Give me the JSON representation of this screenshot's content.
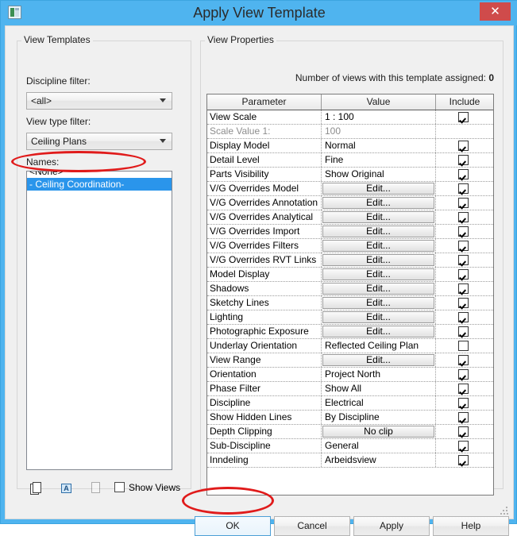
{
  "window": {
    "title": "Apply View Template",
    "app_icon": "application-window-icon",
    "close_label": "✕"
  },
  "left_panel": {
    "group_title": "View Templates",
    "discipline_filter": {
      "label": "Discipline filter:",
      "value": "<all>"
    },
    "view_type_filter": {
      "label": "View type filter:",
      "value": "Ceiling Plans"
    },
    "names": {
      "label": "Names:",
      "items": [
        {
          "text": "<None>",
          "selected": false
        },
        {
          "text": "- Ceiling Coordination-",
          "selected": true
        }
      ]
    },
    "tools": [
      {
        "name": "duplicate-icon",
        "title": "Duplicate",
        "enabled": true
      },
      {
        "name": "rename-icon",
        "title": "Rename",
        "enabled": true,
        "glyph": "A"
      },
      {
        "name": "delete-icon",
        "title": "Delete",
        "enabled": false
      }
    ],
    "show_views": {
      "label": "Show Views",
      "checked": false
    }
  },
  "right_panel": {
    "group_title": "View Properties",
    "views_assigned_label": "Number of views with this template assigned:",
    "views_assigned_count": "0",
    "columns": [
      "Parameter",
      "Value",
      "Include"
    ],
    "rows": [
      {
        "parameter": "View Scale",
        "value": "1 : 100",
        "type": "text",
        "include": true,
        "disabled": false
      },
      {
        "parameter": "Scale Value      1:",
        "value": "100",
        "type": "text",
        "include": null,
        "disabled": true
      },
      {
        "parameter": "Display Model",
        "value": "Normal",
        "type": "text",
        "include": true,
        "disabled": false
      },
      {
        "parameter": "Detail Level",
        "value": "Fine",
        "type": "text",
        "include": true,
        "disabled": false
      },
      {
        "parameter": "Parts Visibility",
        "value": "Show Original",
        "type": "text",
        "include": true,
        "disabled": false
      },
      {
        "parameter": "V/G Overrides Model",
        "value": "Edit...",
        "type": "button",
        "include": true,
        "disabled": false
      },
      {
        "parameter": "V/G Overrides Annotation",
        "value": "Edit...",
        "type": "button",
        "include": true,
        "disabled": false
      },
      {
        "parameter": "V/G Overrides Analytical",
        "value": "Edit...",
        "type": "button",
        "include": true,
        "disabled": false
      },
      {
        "parameter": "V/G Overrides Import",
        "value": "Edit...",
        "type": "button",
        "include": true,
        "disabled": false
      },
      {
        "parameter": "V/G Overrides Filters",
        "value": "Edit...",
        "type": "button",
        "include": true,
        "disabled": false
      },
      {
        "parameter": "V/G Overrides RVT Links",
        "value": "Edit...",
        "type": "button",
        "include": true,
        "disabled": false
      },
      {
        "parameter": "Model Display",
        "value": "Edit...",
        "type": "button",
        "include": true,
        "disabled": false
      },
      {
        "parameter": "Shadows",
        "value": "Edit...",
        "type": "button",
        "include": true,
        "disabled": false
      },
      {
        "parameter": "Sketchy Lines",
        "value": "Edit...",
        "type": "button",
        "include": true,
        "disabled": false
      },
      {
        "parameter": "Lighting",
        "value": "Edit...",
        "type": "button",
        "include": true,
        "disabled": false
      },
      {
        "parameter": "Photographic Exposure",
        "value": "Edit...",
        "type": "button",
        "include": true,
        "disabled": false
      },
      {
        "parameter": "Underlay Orientation",
        "value": "Reflected Ceiling Plan",
        "type": "text",
        "include": false,
        "disabled": false
      },
      {
        "parameter": "View Range",
        "value": "Edit...",
        "type": "button",
        "include": true,
        "disabled": false
      },
      {
        "parameter": "Orientation",
        "value": "Project North",
        "type": "text",
        "include": true,
        "disabled": false
      },
      {
        "parameter": "Phase Filter",
        "value": "Show All",
        "type": "text",
        "include": true,
        "disabled": false
      },
      {
        "parameter": "Discipline",
        "value": "Electrical",
        "type": "text",
        "include": true,
        "disabled": false
      },
      {
        "parameter": "Show Hidden Lines",
        "value": "By Discipline",
        "type": "text",
        "include": true,
        "disabled": false
      },
      {
        "parameter": "Depth Clipping",
        "value": "No clip",
        "type": "button",
        "include": true,
        "disabled": false
      },
      {
        "parameter": "Sub-Discipline",
        "value": "General",
        "type": "text",
        "include": true,
        "disabled": false
      },
      {
        "parameter": "Inndeling",
        "value": "Arbeidsview",
        "type": "text",
        "include": true,
        "disabled": false
      }
    ]
  },
  "buttons": {
    "ok": "OK",
    "cancel": "Cancel",
    "apply": "Apply",
    "help": "Help"
  },
  "annotations": {
    "highlight_color": "#e01b1b",
    "ovals": [
      "names-selected-item",
      "ok-button"
    ]
  },
  "colors": {
    "titlebar": "#4fb4ef",
    "close": "#cf4b4b",
    "selection": "#2a95eb",
    "dialog": "#f0f0f0"
  }
}
